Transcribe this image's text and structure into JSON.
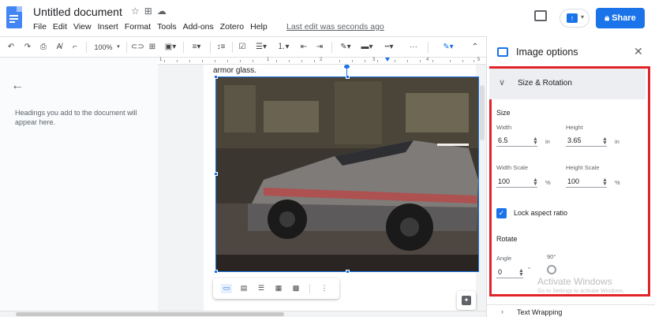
{
  "header": {
    "doc_title": "Untitled document",
    "menu": [
      "File",
      "Edit",
      "View",
      "Insert",
      "Format",
      "Tools",
      "Add-ons",
      "Zotero",
      "Help"
    ],
    "last_edit": "Last edit was seconds ago",
    "share_label": "Share"
  },
  "toolbar": {
    "zoom": "100%",
    "more": "···"
  },
  "ruler": {
    "numbers": [
      "1",
      "1",
      "2",
      "3",
      "4",
      "5"
    ]
  },
  "outline": {
    "hint": "Headings you add to the document will appear here."
  },
  "document": {
    "body_text": "armor glass."
  },
  "panel": {
    "title": "Image options",
    "section_open": "Size & Rotation",
    "size_heading": "Size",
    "width_label": "Width",
    "width_value": "6.5",
    "width_unit": "in",
    "height_label": "Height",
    "height_value": "3.65",
    "height_unit": "in",
    "width_scale_label": "Width Scale",
    "width_scale_value": "100",
    "height_scale_label": "Height Scale",
    "height_scale_value": "100",
    "percent_unit": "%",
    "lock_label": "Lock aspect ratio",
    "rotate_heading": "Rotate",
    "angle_label": "Angle",
    "angle_value": "0",
    "degree_symbol": "°",
    "rotate_90_label": "90°",
    "next_section": "Text Wrapping"
  },
  "watermark": {
    "line1": "Activate Windows",
    "line2": "Go to Settings to activate Windows."
  },
  "colors": {
    "accent": "#1a73e8",
    "highlight_border": "#e0242a"
  }
}
